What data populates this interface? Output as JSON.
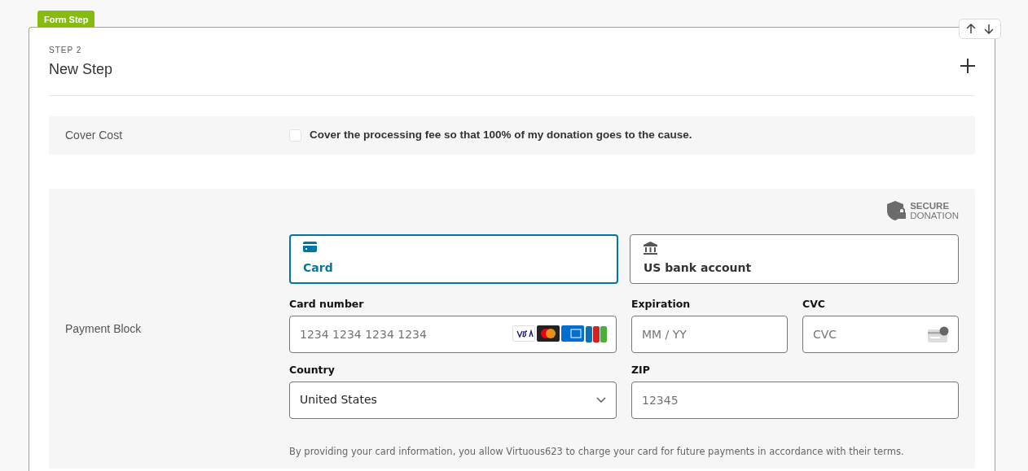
{
  "frame_tag": "Form Step",
  "step": {
    "label": "STEP 2",
    "title": "New Step"
  },
  "cover_cost": {
    "label": "Cover Cost",
    "checkbox": {
      "text": "Cover the processing fee so that 100% of my donation goes to the cause.",
      "checked": false
    }
  },
  "payment": {
    "label": "Payment Block",
    "badge": {
      "line_1": "SECURE",
      "line_2": "DONATION"
    },
    "methods": [
      {
        "kind": "card",
        "label": "Card",
        "selected": true
      },
      {
        "kind": "bank",
        "label": "US bank account",
        "selected": false
      }
    ],
    "fields": [
      {
        "kind": "card_number",
        "label": "Card number",
        "placeholder": "1234 1234 1234 1234"
      },
      {
        "kind": "expiration",
        "label": "Expiration",
        "placeholder": "MM / YY"
      },
      {
        "kind": "cvc",
        "label": "CVC",
        "placeholder": "CVC"
      },
      {
        "kind": "select",
        "label": "Country",
        "value": "United States"
      },
      {
        "kind": "zip",
        "label": "ZIP",
        "placeholder": "12345"
      }
    ],
    "disclaimer": "By providing your card information, you allow Virtuous623 to charge your card for future payments in accordance with their terms."
  }
}
